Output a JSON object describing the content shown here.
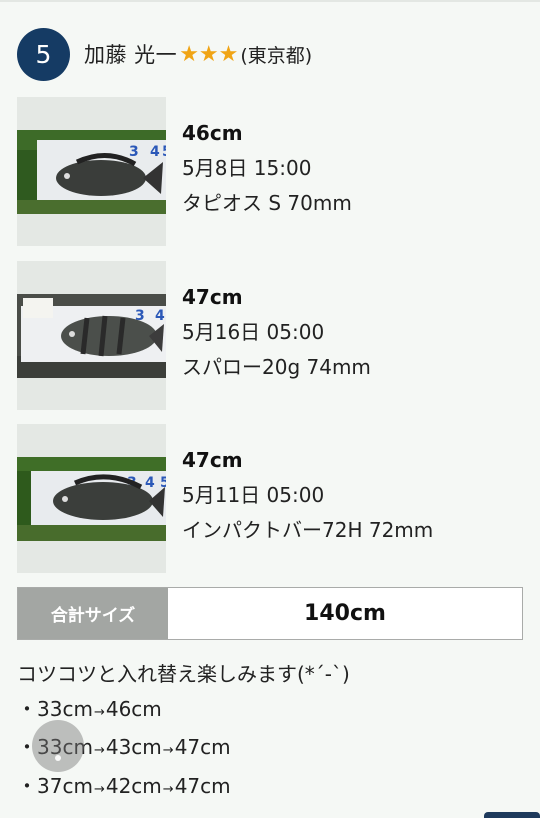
{
  "entry": {
    "rank": "5",
    "angler_name": "加藤 光一",
    "stars": "★★★",
    "region": "(東京都)"
  },
  "catches": [
    {
      "size": "46cm",
      "date": "5月8日 15:00",
      "lure": "タピオス S 70mm"
    },
    {
      "size": "47cm",
      "date": "5月16日 05:00",
      "lure": "スパロー20g 74mm"
    },
    {
      "size": "47cm",
      "date": "5月11日 05:00",
      "lure": "インパクトバー72H 72mm"
    }
  ],
  "total": {
    "label": "合計サイズ",
    "value": "140cm"
  },
  "comment": {
    "intro": "コツコツと入れ替え楽しみます(*´-`)",
    "bullet": "・",
    "arrow": "→",
    "progressions": [
      [
        "33cm",
        "46cm"
      ],
      [
        "33cm",
        "43cm",
        "47cm"
      ],
      [
        "37cm",
        "42cm",
        "47cm"
      ]
    ]
  },
  "colors": {
    "accent": "#153b64",
    "star": "#f0a415",
    "total_label_bg": "#a3a6a3"
  }
}
